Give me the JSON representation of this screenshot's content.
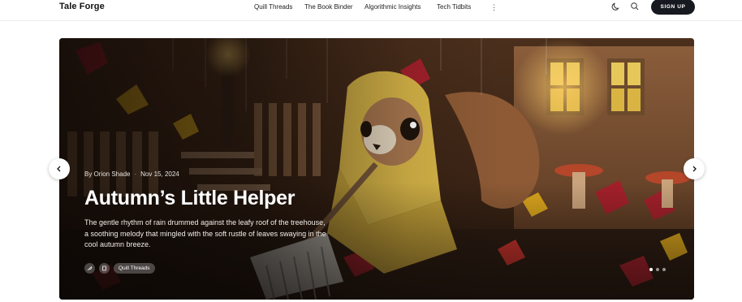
{
  "header": {
    "brand": "Tale Forge",
    "nav": [
      "Quill Threads",
      "The Book Binder",
      "Algorithmic Insights",
      "Tech Tidbits"
    ],
    "more_icon": "more-vertical-icon",
    "theme_icon": "moon-icon",
    "search_icon": "search-icon",
    "signup_label": "SIGN UP"
  },
  "hero": {
    "author": "By Orion Shade",
    "date": "Nov 15, 2024",
    "title": "Autumn’s Little Helper",
    "excerpt": "The gentle rhythm of rain drummed against the leafy roof of the treehouse, a soothing melody that mingled with the soft rustle of leaves swaying in the cool autumn breeze.",
    "tag_icons": [
      "feather-icon",
      "book-icon"
    ],
    "tag_label": "Quill Threads",
    "slide_count": 3,
    "active_slide": 1,
    "prev_icon": "chevron-left-icon",
    "next_icon": "chevron-right-icon"
  },
  "colors": {
    "accent": "#16191f",
    "hero_dark": "#3a2417",
    "leaf_red": "#a3202b",
    "leaf_yellow": "#d9a51c",
    "raincoat": "#d8b648"
  }
}
